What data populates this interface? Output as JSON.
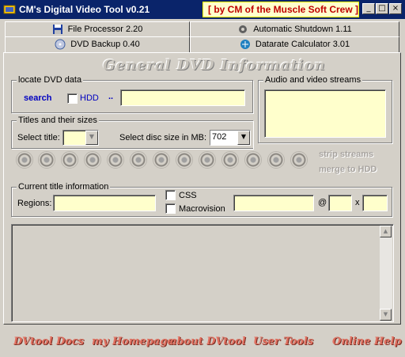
{
  "window": {
    "title": "CM's Digital Video Tool v0.21",
    "subtitle": "[ by CM of the Muscle Soft Crew ]",
    "minimize": "_",
    "maximize": "□",
    "close": "×"
  },
  "tabs": [
    {
      "label": "File Processor 2.20",
      "icon": "floppy-icon"
    },
    {
      "label": "Automatic Shutdown 1.11",
      "icon": "gear-icon"
    },
    {
      "label": "DVD Backup 0.40",
      "icon": "dvd-icon",
      "active": true
    },
    {
      "label": "Datarate Calculator 3.01",
      "icon": "calculator-icon"
    }
  ],
  "banner": "General DVD Information",
  "locate": {
    "legend": "locate DVD data",
    "search_label": "search",
    "hdd_label": "HDD",
    "browse_label": "..",
    "path_value": ""
  },
  "streams": {
    "legend": "Audio and video streams"
  },
  "titles": {
    "legend": "Titles and their sizes",
    "select_title_label": "Select title:",
    "select_title_value": "",
    "disc_size_label": "Select disc size in MB:",
    "disc_size_value": "702",
    "strip_label": "strip streams",
    "merge_label": "merge to HDD",
    "title_buttons_count": 13
  },
  "current": {
    "legend": "Current title information",
    "regions_label": "Regions:",
    "regions_value": "",
    "css_label": "CSS",
    "macrovision_label": "Macrovision",
    "at_label": "@",
    "x_label": "x"
  },
  "bottom_links": [
    "DVtool Docs",
    "my Homepage",
    "about DVtool",
    "User Tools",
    "Online Help"
  ],
  "colors": {
    "titlebar": "#0a246a",
    "field_bg": "#ffffcc",
    "link_blue": "#0000c0",
    "bottom_link": "#e07060"
  }
}
